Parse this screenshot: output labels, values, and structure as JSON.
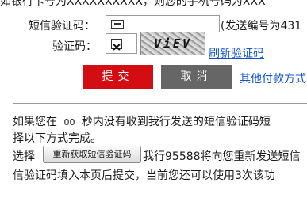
{
  "top_cut_text": "如银行卡号为XXXXXXXXXX，则您的手机号码为XXX",
  "sms_code": {
    "label": "短信验证码：",
    "serial_note": "(发送编号为431"
  },
  "verify_code": {
    "label": "验证码：",
    "captcha_text": "ViEV",
    "refresh_link": "刷新验证码"
  },
  "actions": {
    "submit_label": "提交",
    "cancel_label": "取消",
    "other_payment_link": "其他付款方式"
  },
  "notice": {
    "line1_prefix": "如果您在",
    "countdown": "00",
    "line1_suffix": "秒内没有收到我行发送的短信验证码短",
    "line2": "择以下方式完成。",
    "line3_prefix": "选择",
    "resend_button_label": "重新获取短信验证码",
    "line3_suffix": "我行95588将向您重新发送短信",
    "line4": "信验证码填入本页后提交，当前您还可以使用3次该功"
  }
}
